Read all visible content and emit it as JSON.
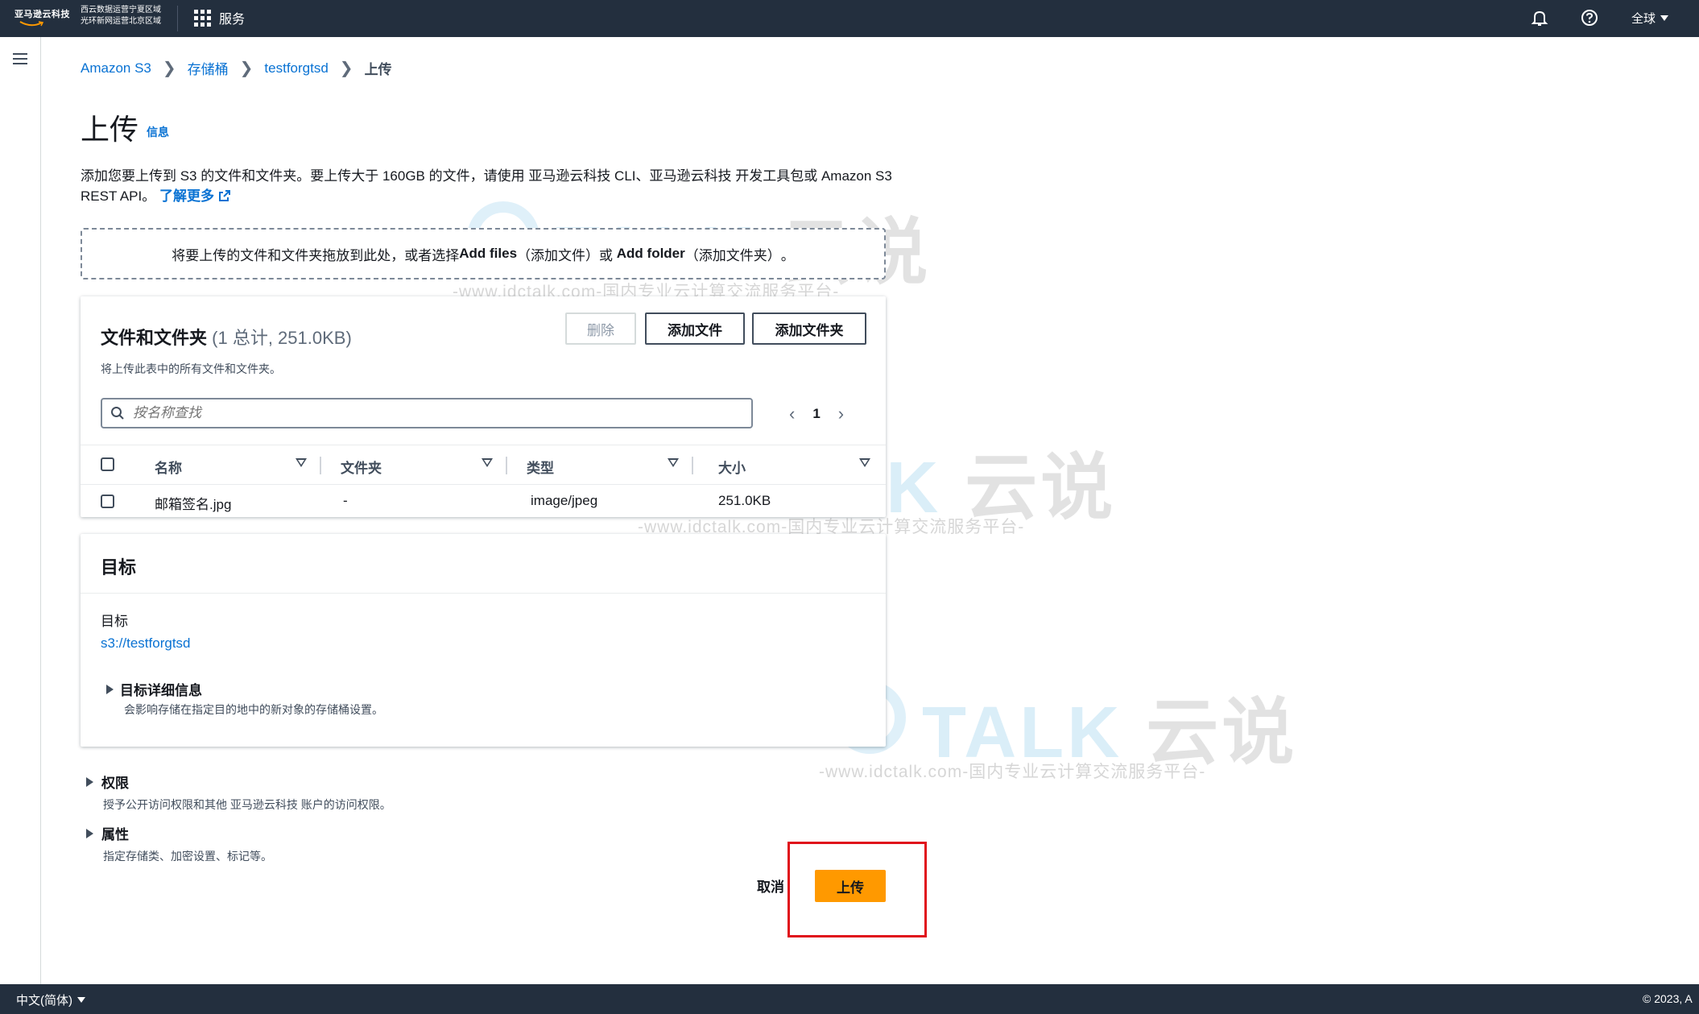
{
  "topnav": {
    "logo_text": "亚马逊云科技",
    "region_line1": "西云数据运营宁夏区域",
    "region_line2": "光环新网运营北京区域",
    "services_label": "服务",
    "global_label": "全球"
  },
  "breadcrumb": {
    "items": [
      "Amazon S3",
      "存储桶",
      "testforgtsd"
    ],
    "current": "上传"
  },
  "page": {
    "title": "上传",
    "info_link": "信息",
    "description": "添加您要上传到 S3 的文件和文件夹。要上传大于 160GB 的文件，请使用 亚马逊云科技 CLI、亚马逊云科技 开发工具包或 Amazon S3 REST API。",
    "learn_more": "了解更多"
  },
  "dropzone": {
    "text_before": "将要上传的文件和文件夹拖放到此处，或者选择",
    "add_files": "Add files",
    "add_files_cn": "（添加文件）",
    "or": "或",
    "add_folder": "Add folder",
    "add_folder_cn": "（添加文件夹）",
    "end": "。"
  },
  "files_panel": {
    "title": "文件和文件夹",
    "count": "(1 总计, 251.0KB)",
    "subtitle": "将上传此表中的所有文件和文件夹。",
    "delete_label": "删除",
    "add_files_label": "添加文件",
    "add_folder_label": "添加文件夹",
    "search_placeholder": "按名称查找",
    "page_number": "1",
    "columns": [
      "名称",
      "文件夹",
      "类型",
      "大小"
    ],
    "rows": [
      {
        "name": "邮箱签名.jpg",
        "folder": "-",
        "type": "image/jpeg",
        "size": "251.0KB"
      }
    ]
  },
  "target_panel": {
    "title": "目标",
    "label": "目标",
    "link": "s3://testforgtsd",
    "details_title": "目标详细信息",
    "details_sub": "会影响存储在指定目的地中的新对象的存储桶设置。"
  },
  "permissions": {
    "title": "权限",
    "sub": "授予公开访问权限和其他 亚马逊云科技 账户的访问权限。"
  },
  "properties": {
    "title": "属性",
    "sub": "指定存储类、加密设置、标记等。"
  },
  "actions": {
    "cancel_label": "取消",
    "upload_label": "上传"
  },
  "footer": {
    "language": "中文(简体)",
    "copyright": "© 2023, A"
  },
  "watermark": {
    "talk": "TALK",
    "cn": "云说",
    "url": "-www.idctalk.com-国内专业云计算交流服务平台-"
  },
  "colors": {
    "nav_bg": "#232f3e",
    "link": "#0972d3",
    "primary_button": "#ff9900",
    "highlight": "#e0101b"
  }
}
